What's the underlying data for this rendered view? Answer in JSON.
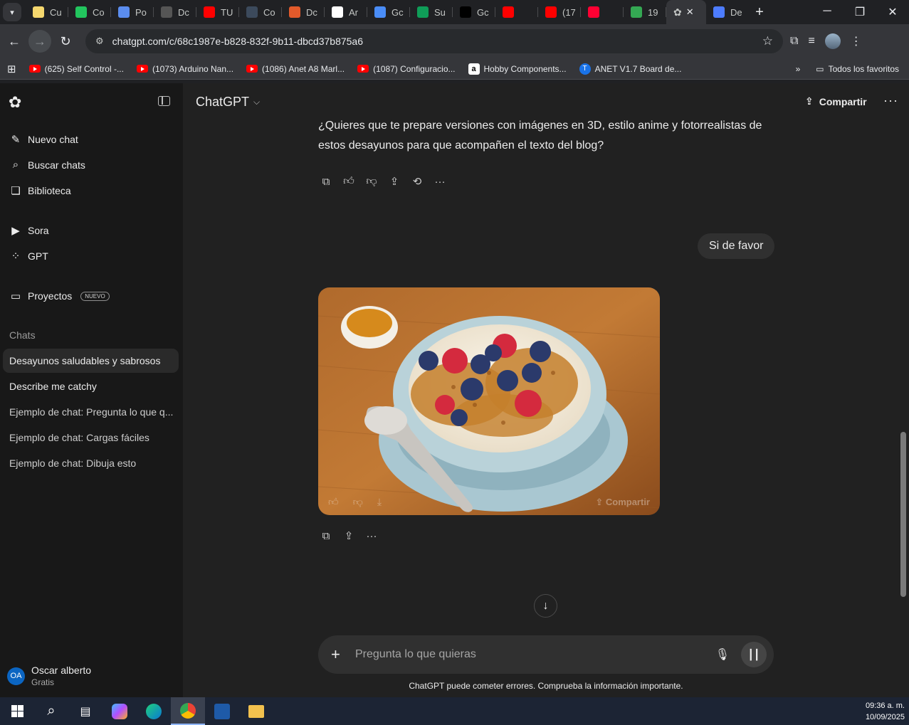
{
  "browser": {
    "tabs": [
      {
        "label": "Cu",
        "color": "#f5d76e"
      },
      {
        "label": "Co",
        "color": "#22c55e"
      },
      {
        "label": "Po",
        "color": "#5b8def"
      },
      {
        "label": "Dc",
        "color": "#555555"
      },
      {
        "label": "TU",
        "color": "#ff0000"
      },
      {
        "label": "Co",
        "color": "#3c4a5c"
      },
      {
        "label": "Dc",
        "color": "#e25a2b"
      },
      {
        "label": "Ar",
        "color": "#ffffff"
      },
      {
        "label": "Gc",
        "color": "#4a8df8"
      },
      {
        "label": "Su",
        "color": "#0f9d58"
      },
      {
        "label": "Gc",
        "color": "#000000"
      },
      {
        "label": "",
        "color": "#ff0000"
      },
      {
        "label": "(17",
        "color": "#ff0000"
      },
      {
        "label": "",
        "color": "#ff0033"
      },
      {
        "label": "19",
        "color": "#34a853"
      }
    ],
    "active_tab_close": "✕",
    "last_tab": {
      "label": "De",
      "color": "#4d7cfe"
    },
    "url": "chatgpt.com/c/68c1987e-b828-832f-9b11-dbcd37b875a6",
    "bookmarks": [
      {
        "label": "(625) Self Control -...",
        "type": "yt"
      },
      {
        "label": "(1073) Arduino Nan...",
        "type": "yt"
      },
      {
        "label": "(1086) Anet A8 Marl...",
        "type": "yt"
      },
      {
        "label": "(1087) Configuracio...",
        "type": "yt"
      },
      {
        "label": "Hobby Components...",
        "type": "amazon"
      },
      {
        "label": "ANET V1.7 Board de...",
        "type": "translate"
      }
    ],
    "all_bookmarks": "Todos los favoritos"
  },
  "sidebar": {
    "nav": [
      {
        "label": "Nuevo chat",
        "icon": "✎"
      },
      {
        "label": "Buscar chats",
        "icon": "⌕"
      },
      {
        "label": "Biblioteca",
        "icon": "❏"
      },
      {
        "label": "Sora",
        "icon": "▶"
      },
      {
        "label": "GPT",
        "icon": "⁘"
      },
      {
        "label": "Proyectos",
        "icon": "▭"
      }
    ],
    "projects_badge": "NUEVO",
    "section_title": "Chats",
    "chats": [
      "Desayunos saludables y sabrosos",
      "Describe me catchy",
      "Ejemplo de chat: Pregunta lo que q...",
      "Ejemplo de chat: Cargas fáciles",
      "Ejemplo de chat: Dibuja esto"
    ],
    "user": {
      "initials": "OA",
      "name": "Oscar alberto",
      "plan": "Gratis"
    }
  },
  "main": {
    "model": "ChatGPT",
    "share": "Compartir",
    "assistant_message": "¿Quieres que te prepare versiones con imágenes en 3D, estilo anime y fotorrealistas de estos desayunos para que acompañen el texto del blog?",
    "user_message": "Si de favor",
    "image_share": "Compartir",
    "composer_placeholder": "Pregunta lo que quieras",
    "disclaimer": "ChatGPT puede cometer errores. Comprueba la información importante."
  },
  "taskbar": {
    "time": "09:36 a. m.",
    "date": "10/09/2025"
  }
}
